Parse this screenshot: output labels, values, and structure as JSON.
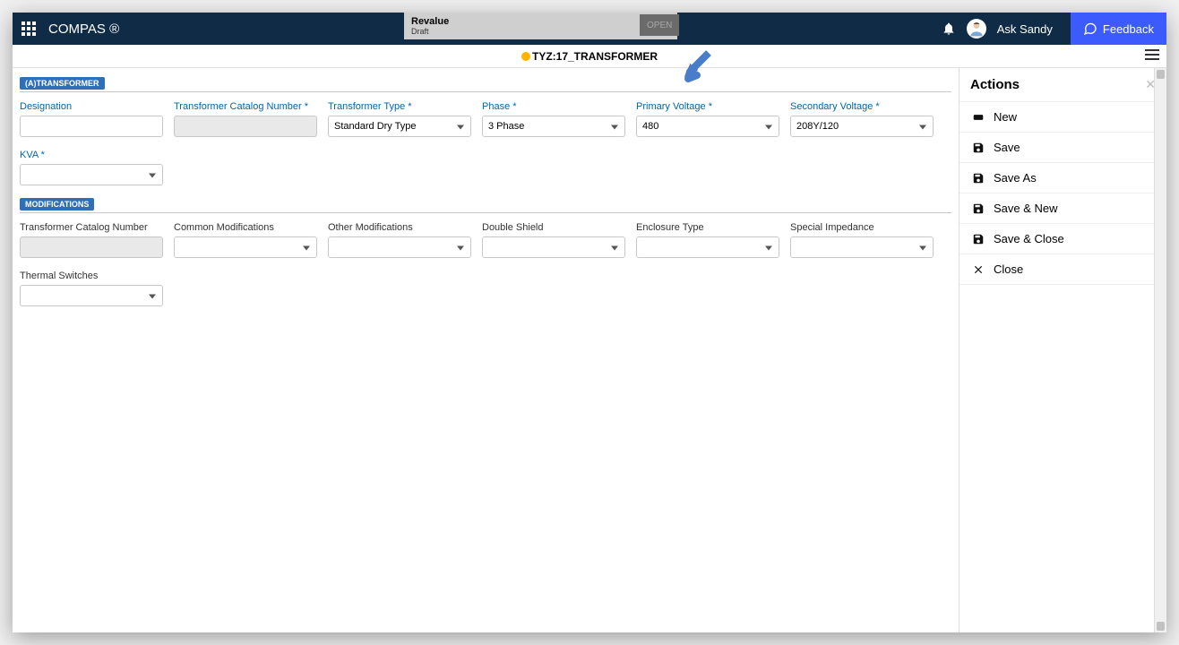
{
  "brand": "COMPAS ®",
  "revalue": {
    "title": "Revalue",
    "status": "Draft",
    "open": "OPEN"
  },
  "ask_sandy": "Ask Sandy",
  "feedback": "Feedback",
  "breadcrumb": "TYZ:17_TRANSFORMER",
  "sections": {
    "transformer": "(A)TRANSFORMER",
    "modifications": "MODIFICATIONS"
  },
  "fields": {
    "designation": {
      "label": "Designation",
      "value": ""
    },
    "catalog_number": {
      "label": "Transformer Catalog Number *",
      "value": ""
    },
    "type": {
      "label": "Transformer Type *",
      "value": "Standard Dry Type"
    },
    "phase": {
      "label": "Phase *",
      "value": "3 Phase"
    },
    "primary_voltage": {
      "label": "Primary Voltage *",
      "value": "480"
    },
    "secondary_voltage": {
      "label": "Secondary Voltage *",
      "value": "208Y/120"
    },
    "kva": {
      "label": "KVA *",
      "value": ""
    },
    "mod_catalog": {
      "label": "Transformer Catalog Number",
      "value": ""
    },
    "common_mods": {
      "label": "Common Modifications",
      "value": ""
    },
    "other_mods": {
      "label": "Other Modifications",
      "value": ""
    },
    "double_shield": {
      "label": "Double Shield",
      "value": ""
    },
    "enclosure": {
      "label": "Enclosure Type",
      "value": ""
    },
    "impedance": {
      "label": "Special Impedance",
      "value": ""
    },
    "thermal": {
      "label": "Thermal Switches",
      "value": ""
    }
  },
  "actions": {
    "header": "Actions",
    "items": {
      "new": "New",
      "save": "Save",
      "save_as": "Save As",
      "save_new": "Save & New",
      "save_close": "Save & Close",
      "close": "Close"
    }
  }
}
